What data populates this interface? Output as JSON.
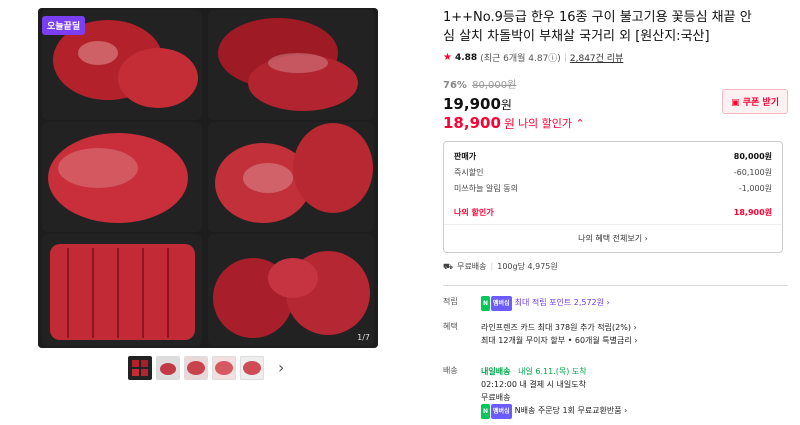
{
  "gallery": {
    "badge": "오늘끝딜",
    "counter": "1/7",
    "prev_icon": "chevron-left-icon",
    "next_icon": "chevron-right-icon",
    "thumb_count": 5
  },
  "product": {
    "title": "1++No.9등급 한우 16종 구이 불고기용 꽃등심 채끝 안심 살치 차돌박이 부채살 국거리 외 [원산지:국산]",
    "rating": "4.88",
    "rating_detail": "(최근 6개월 4.87ⓘ)",
    "reviews": "2,847건 리뷰",
    "discount_pct": "76%",
    "original_price": "80,000원",
    "price": "19,900",
    "price_unit": "원",
    "sale_price": "18,900",
    "sale_unit": "원",
    "my_discount": "나의 할인가 ⌃"
  },
  "coupon": {
    "label": "쿠폰 받기"
  },
  "price_box": {
    "rows": [
      {
        "label": "판매가",
        "value": "80,000원"
      },
      {
        "label": "즉시할인",
        "value": "-60,100원"
      },
      {
        "label": "미쓰하늘 알림 동의",
        "value": "-1,000원"
      }
    ],
    "total_label": "나의 할인가",
    "total_value": "18,900원",
    "benefit_link": "나의 혜택 전체보기 ›"
  },
  "shipping": {
    "label": "무료배송",
    "detail": "100g당 4,975원"
  },
  "info": {
    "points_label": "적립",
    "points_text": "최대 적립 포인트 2,572원 ›",
    "benefit_label": "혜택",
    "benefit_line1": "라인프렌즈 카드 최대 378원 추가 적립(2%) ›",
    "benefit_line2": "최대 12개월 무이자 할부 • 60개월 특별금리 ›",
    "delivery_label": "배송",
    "delivery_badge": "내일배송",
    "delivery_date": "내일 6.11.(목) 도착",
    "delivery_cut": "02:12:00  내 결제 시 내일도착",
    "delivery_free": "무료배송",
    "delivery_return": "N배송 주문당 1회 무료교환반품 ›",
    "npay": "N",
    "nplus": "멤버십"
  }
}
